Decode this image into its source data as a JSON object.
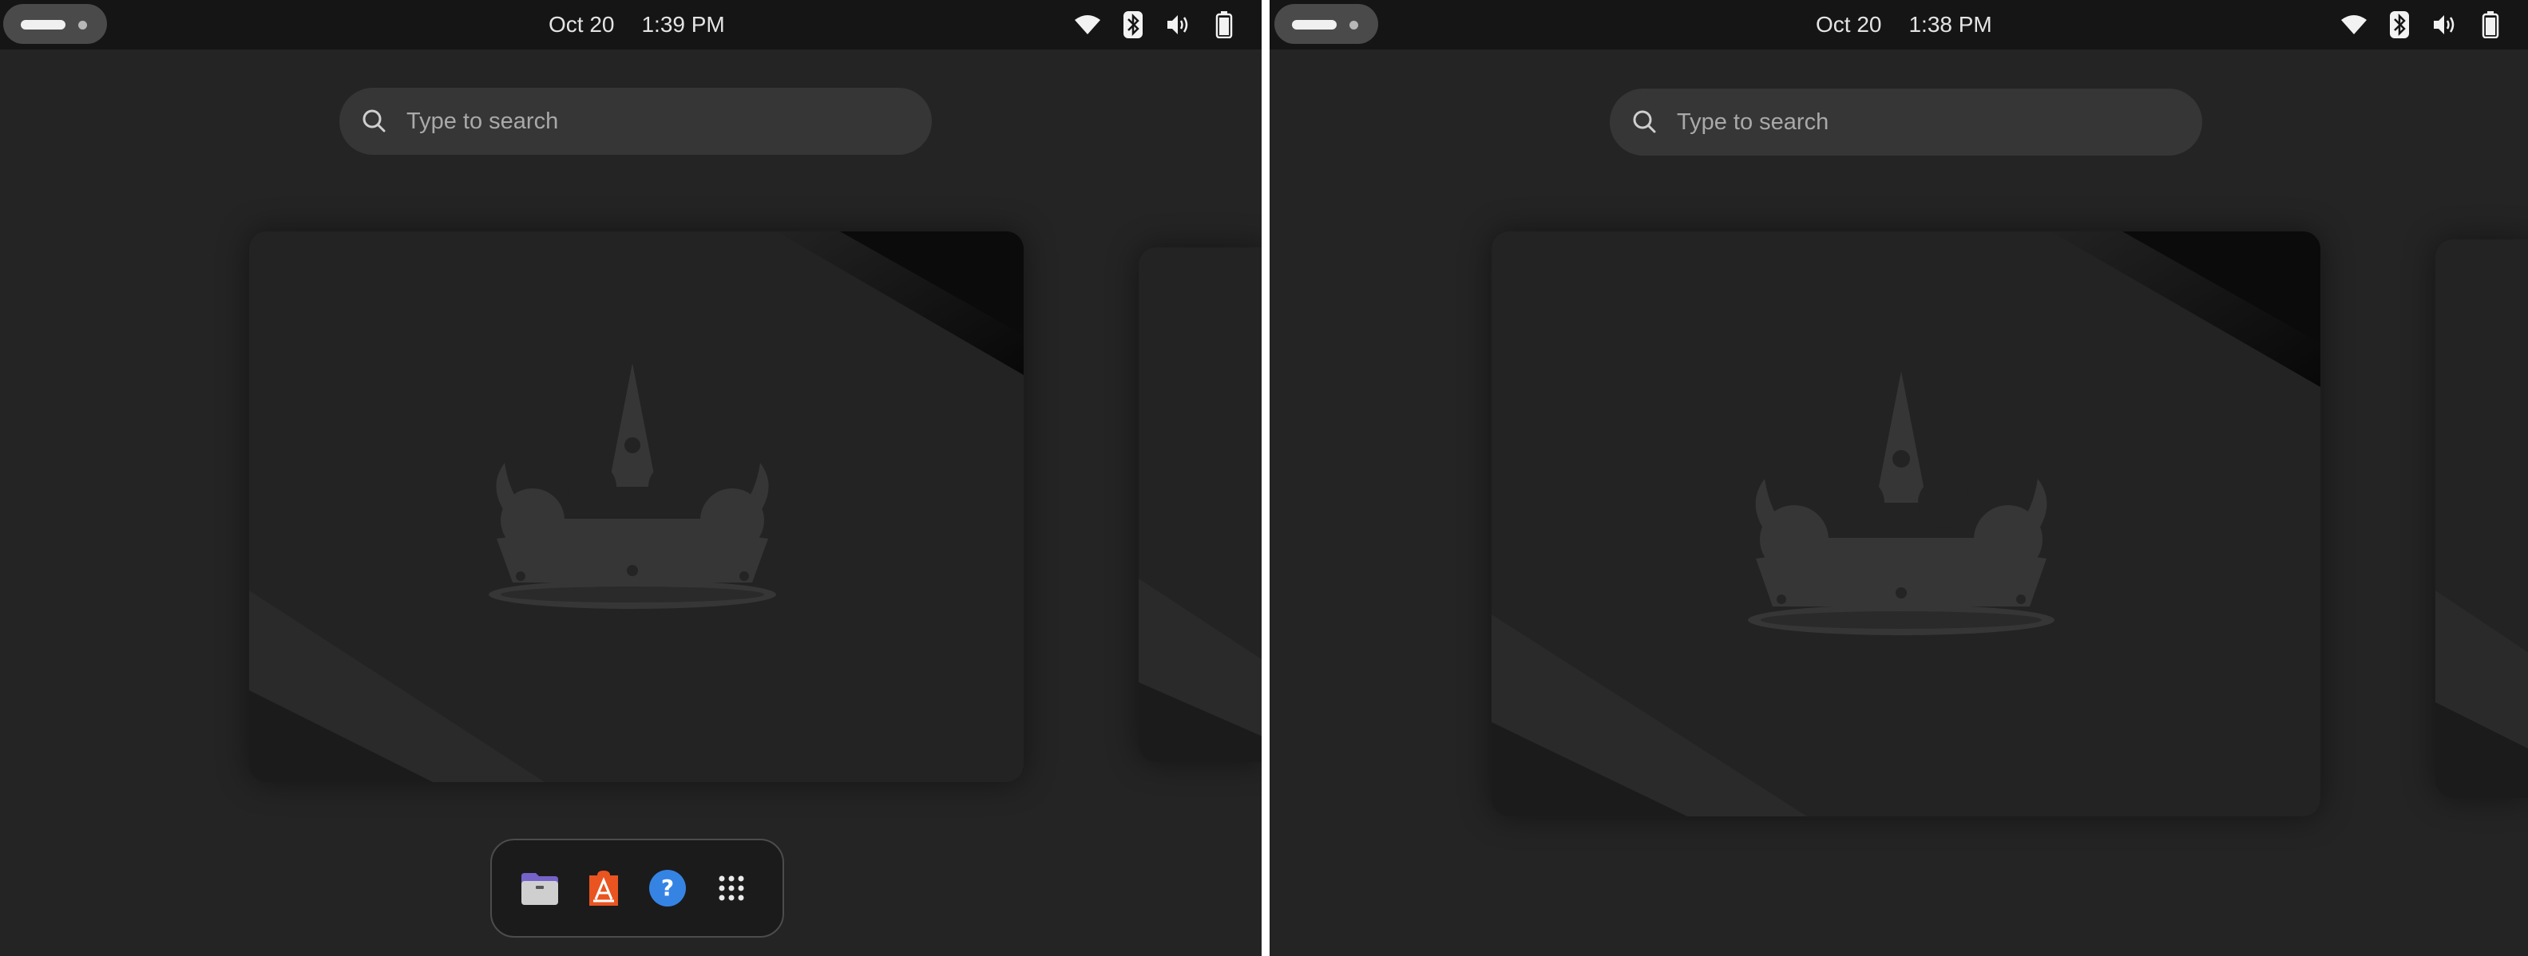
{
  "screens": [
    {
      "topbar": {
        "date": "Oct 20",
        "time": "1:39 PM",
        "tray_icons": [
          "wifi-icon",
          "bluetooth-icon",
          "volume-icon",
          "battery-icon"
        ]
      },
      "search": {
        "placeholder": "Type to search"
      },
      "dash": {
        "items": [
          {
            "name": "files-icon"
          },
          {
            "name": "app-center-icon"
          },
          {
            "name": "help-icon"
          },
          {
            "name": "show-apps-icon"
          }
        ]
      }
    },
    {
      "topbar": {
        "date": "Oct 20",
        "time": "1:38 PM",
        "tray_icons": [
          "wifi-icon",
          "bluetooth-icon",
          "volume-icon",
          "battery-icon"
        ]
      },
      "search": {
        "placeholder": "Type to search"
      }
    }
  ],
  "colors": {
    "panel": "#151515",
    "background": "#242424",
    "search_field": "#363636",
    "help_blue": "#3584e4",
    "app_center_orange": "#e95420",
    "files_purple": "#8c7ae6"
  }
}
